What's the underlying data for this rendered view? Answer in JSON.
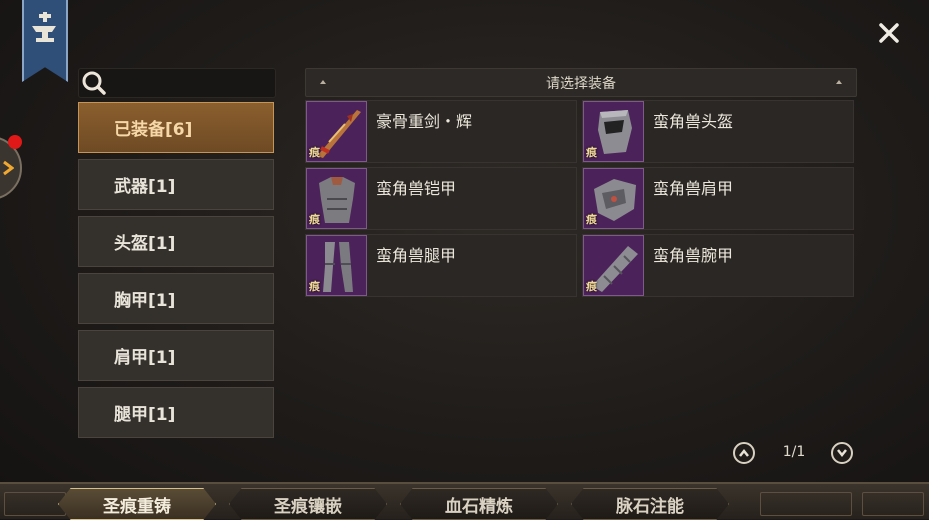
{
  "search": {
    "placeholder": ""
  },
  "header": {
    "title": "请选择装备"
  },
  "categories": [
    {
      "label": "已装备[6]",
      "active": true
    },
    {
      "label": "武器[1]"
    },
    {
      "label": "头盔[1]"
    },
    {
      "label": "胸甲[1]"
    },
    {
      "label": "肩甲[1]"
    },
    {
      "label": "腿甲[1]"
    }
  ],
  "items": [
    {
      "name": "豪骨重剑・辉",
      "mark": "痕",
      "icon": "greatsword-icon"
    },
    {
      "name": "蛮角兽头盔",
      "mark": "痕",
      "icon": "helmet-icon"
    },
    {
      "name": "蛮角兽铠甲",
      "mark": "痕",
      "icon": "chest-armor-icon"
    },
    {
      "name": "蛮角兽肩甲",
      "mark": "痕",
      "icon": "shoulder-armor-icon"
    },
    {
      "name": "蛮角兽腿甲",
      "mark": "痕",
      "icon": "leg-armor-icon"
    },
    {
      "name": "蛮角兽腕甲",
      "mark": "痕",
      "icon": "bracer-icon"
    }
  ],
  "pager": {
    "page": "1/1"
  },
  "bottom_tabs": [
    {
      "label": "圣痕重铸",
      "active": true
    },
    {
      "label": "圣痕镶嵌"
    },
    {
      "label": "血石精炼"
    },
    {
      "label": "脉石注能"
    }
  ],
  "colors": {
    "accent": "#c59457",
    "thumb_bg": "#4b2259",
    "notification": "#e01818"
  }
}
